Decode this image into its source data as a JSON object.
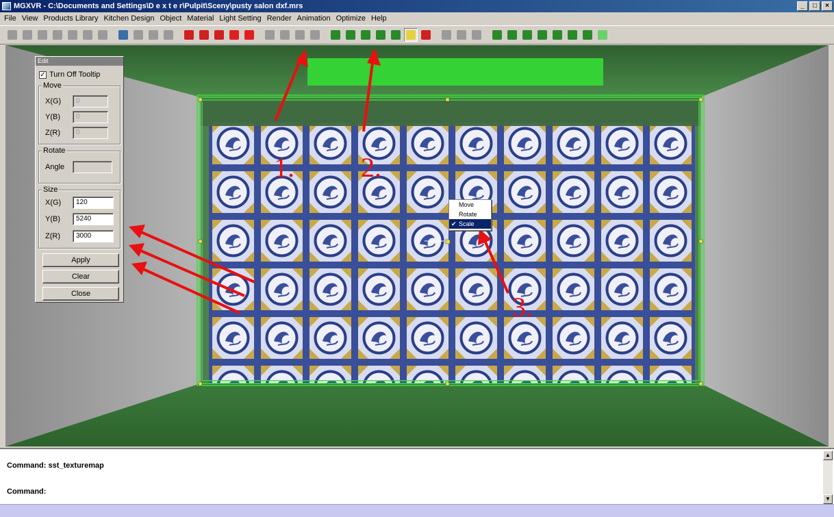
{
  "window": {
    "title": "MGXVR - C:\\Documents and Settings\\D e x t e r\\Pulpit\\Sceny\\pusty salon dxf.mrs",
    "controls": [
      "_",
      "□",
      "×"
    ]
  },
  "menu": [
    "File",
    "View",
    "Products Library",
    "Kitchen Design",
    "Object",
    "Material",
    "Light Setting",
    "Render",
    "Animation",
    "Optimize",
    "Help"
  ],
  "toolbar": {
    "icons": [
      {
        "name": "arrow-right-icon",
        "color": "#9a9a9a"
      },
      {
        "name": "double-arrow-icon",
        "color": "#9a9a9a"
      },
      {
        "name": "box-icon",
        "color": "#9a9a9a"
      },
      {
        "name": "slash-icon",
        "color": "#9a9a9a"
      },
      {
        "name": "triangle-icon",
        "color": "#9a9a9a"
      },
      {
        "name": "triangle-box-icon",
        "color": "#9a9a9a"
      },
      {
        "name": "circle-icon",
        "color": "#9a9a9a"
      },
      {
        "name": "render-icon",
        "color": "#3a6ea5"
      },
      {
        "name": "page-icon",
        "color": "#9a9a9a"
      },
      {
        "name": "window-icon",
        "color": "#9a9a9a"
      },
      {
        "name": "copy-icon",
        "color": "#9a9a9a"
      },
      {
        "name": "mirror-icon",
        "color": "#d02020"
      },
      {
        "name": "mirror2-icon",
        "color": "#d02020"
      },
      {
        "name": "rotate-icon",
        "color": "#d02020"
      },
      {
        "name": "move-icon",
        "color": "#e02020"
      },
      {
        "name": "target-icon",
        "color": "#e02020"
      },
      {
        "name": "grid-icon",
        "color": "#9a9a9a"
      },
      {
        "name": "light-icon",
        "color": "#9a9a9a"
      },
      {
        "name": "camera-icon",
        "color": "#9a9a9a"
      },
      {
        "name": "lock-icon",
        "color": "#9a9a9a"
      },
      {
        "name": "select-arrow-icon",
        "color": "#2a8a2a"
      },
      {
        "name": "gem-icon",
        "color": "#2a8a2a"
      },
      {
        "name": "wall-icon",
        "color": "#2a8a2a"
      },
      {
        "name": "cone-icon",
        "color": "#2a8a2a"
      },
      {
        "name": "pyramid-icon",
        "color": "#2a8a2a"
      },
      {
        "name": "texture-map-icon",
        "color": "#e8d040"
      },
      {
        "name": "pointer-icon",
        "color": "#d02020"
      },
      {
        "name": "play-icon",
        "color": "#9a9a9a"
      },
      {
        "name": "stop-icon",
        "color": "#9a9a9a"
      },
      {
        "name": "record-icon",
        "color": "#9a9a9a"
      },
      {
        "name": "cube-front-icon",
        "color": "#2a8a2a"
      },
      {
        "name": "cube-side-icon",
        "color": "#2a8a2a"
      },
      {
        "name": "cube-top-icon",
        "color": "#2a8a2a"
      },
      {
        "name": "cube-iso-icon",
        "color": "#2a8a2a"
      },
      {
        "name": "sphere-icon",
        "color": "#2a8a2a"
      },
      {
        "name": "zoom-icon",
        "color": "#2a8a2a"
      },
      {
        "name": "save-icon",
        "color": "#2a8a2a"
      },
      {
        "name": "refresh-icon",
        "color": "#6ad06a"
      }
    ]
  },
  "edit_panel": {
    "title": "Edit",
    "tooltip_checkbox": "Turn Off Tooltip",
    "tooltip_checked": true,
    "move": {
      "label": "Move",
      "x_label": "X(G)",
      "x_value": "0",
      "y_label": "Y(B)",
      "y_value": "0",
      "z_label": "Z(R)",
      "z_value": "0"
    },
    "rotate": {
      "label": "Rotate",
      "angle_label": "Angle",
      "angle_value": ""
    },
    "size": {
      "label": "Size",
      "x_label": "X(G)",
      "x_value": "120",
      "y_label": "Y(B)",
      "y_value": "5240",
      "z_label": "Z(R)",
      "z_value": "3000"
    },
    "buttons": {
      "apply": "Apply",
      "clear": "Clear",
      "close": "Close"
    }
  },
  "context_menu": {
    "items": [
      "Move",
      "Rotate",
      "Scale"
    ],
    "selected": "Scale"
  },
  "annotations": [
    "1.",
    "2.",
    "3."
  ],
  "command": {
    "line1": "Command: sst_texturemap",
    "line2": "Command:"
  },
  "colors": {
    "accent": "#0a246a",
    "floor": "#2f6b2f",
    "wall_side": "#a8a8a8",
    "selection": "#3cdc3c",
    "arrow": "#e81010",
    "tile_blue": "#3a4f9a"
  }
}
